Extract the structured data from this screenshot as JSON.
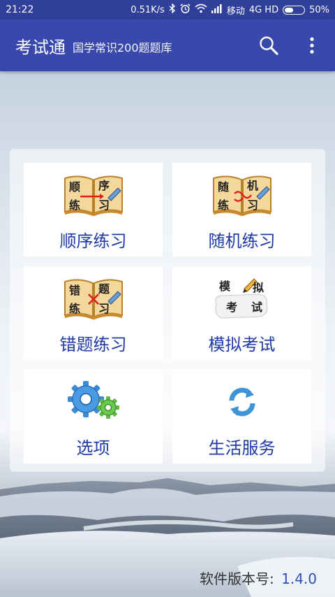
{
  "status_bar": {
    "time": "21:22",
    "speed": "0.51K/s",
    "carrier": "移动",
    "network": "4G HD",
    "battery": "50%",
    "battery_level": 0.5
  },
  "app_bar": {
    "title": "考试通",
    "subtitle": "国学常识200题题库",
    "search_icon": "search-icon",
    "more_icon": "more-vert-icon"
  },
  "menu": {
    "items": [
      {
        "label": "顺序练习",
        "icon": "sequential-book-icon",
        "book_chars": [
          "顺",
          "序",
          "练",
          "习"
        ]
      },
      {
        "label": "随机练习",
        "icon": "random-book-icon",
        "book_chars": [
          "随",
          "机",
          "练",
          "习"
        ]
      },
      {
        "label": "错题练习",
        "icon": "wrong-book-icon",
        "book_chars": [
          "错",
          "题",
          "练",
          "习"
        ]
      },
      {
        "label": "模拟考试",
        "icon": "exam-paper-icon",
        "book_chars": [
          "模",
          "拟",
          "考",
          "试"
        ]
      },
      {
        "label": "选项",
        "icon": "gears-icon"
      },
      {
        "label": "生活服务",
        "icon": "refresh-icon"
      }
    ]
  },
  "footer": {
    "version_label": "软件版本号:",
    "version_number": "1.4.0"
  },
  "colors": {
    "status_bar": "#2f3f9a",
    "app_bar": "#3949ab",
    "tile_label": "#1f3aa6"
  }
}
